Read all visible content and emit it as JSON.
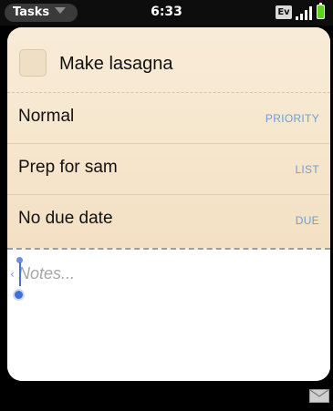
{
  "status_bar": {
    "app_name": "Tasks",
    "time": "6:33",
    "network": "Ev",
    "signal_icon": "signal-bars-icon",
    "battery_icon": "battery-icon"
  },
  "task": {
    "title": "Make lasagna",
    "completed": false,
    "fields": [
      {
        "value": "Normal",
        "label": "PRIORITY"
      },
      {
        "value": "Prep for sam",
        "label": "LIST"
      },
      {
        "value": "No due date",
        "label": "DUE"
      }
    ],
    "notes_placeholder": "Notes..."
  },
  "footer": {
    "notification_icon": "mail-icon"
  },
  "colors": {
    "paper": "#f6e6cd",
    "label_accent": "#6f9fd0",
    "battery": "#5bd21f",
    "cursor": "#4a6fd1"
  }
}
